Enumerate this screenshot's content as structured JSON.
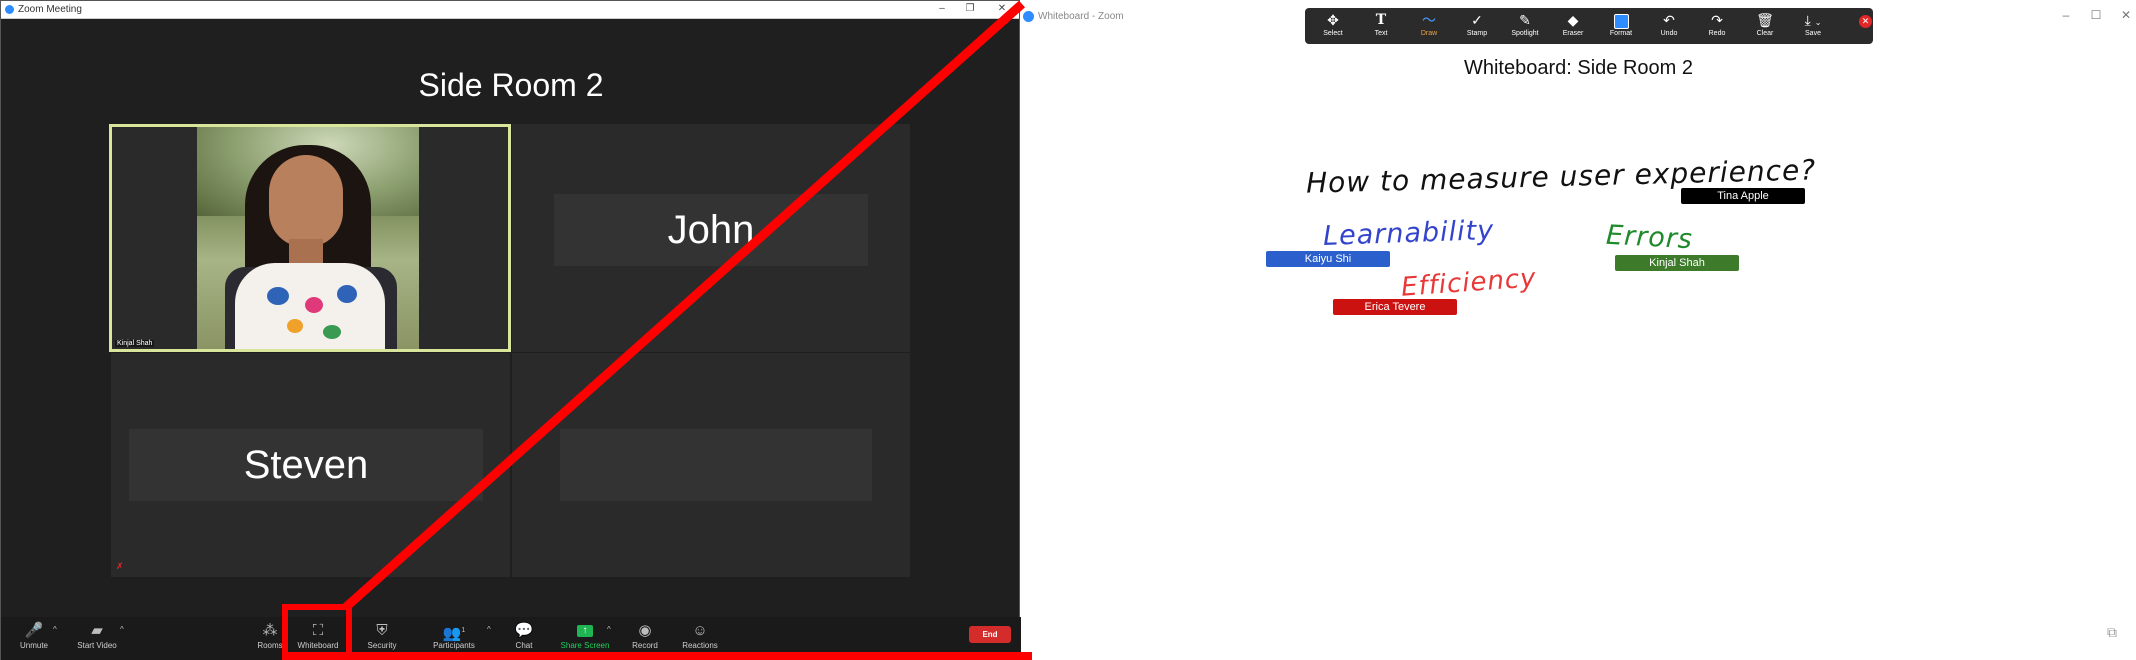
{
  "meeting_window": {
    "title": "Zoom Meeting",
    "room_title": "Side Room 2",
    "tiles": [
      {
        "name": "Kinjal Shah",
        "show_name_plate": false
      },
      {
        "name": "John"
      },
      {
        "name": "Steven"
      },
      {
        "name": ""
      }
    ],
    "toolbar": {
      "unmute": "Unmute",
      "start_video": "Start Video",
      "rooms": "Rooms",
      "whiteboard": "Whiteboard",
      "security": "Security",
      "participants": "Participants",
      "participants_count": "1",
      "chat": "Chat",
      "share_screen": "Share Screen",
      "record": "Record",
      "reactions": "Reactions",
      "end": "End"
    },
    "colors": {
      "share_accent": "#1fd15d",
      "end_red": "#d42b2b",
      "active_border": "#d8e59a"
    }
  },
  "whiteboard_window": {
    "title": "Whiteboard - Zoom",
    "board_title": "Whiteboard: Side Room 2",
    "tools": [
      {
        "id": "select",
        "label": "Select",
        "icon": "move-icon"
      },
      {
        "id": "text",
        "label": "Text",
        "icon": "text-icon"
      },
      {
        "id": "draw",
        "label": "Draw",
        "icon": "squiggle-icon",
        "active": true
      },
      {
        "id": "stamp",
        "label": "Stamp",
        "icon": "check-icon"
      },
      {
        "id": "spotlight",
        "label": "Spotlight",
        "icon": "wand-icon"
      },
      {
        "id": "eraser",
        "label": "Eraser",
        "icon": "eraser-icon"
      },
      {
        "id": "format",
        "label": "Format",
        "icon": "color-swatch-icon"
      },
      {
        "id": "undo",
        "label": "Undo",
        "icon": "undo-icon"
      },
      {
        "id": "redo",
        "label": "Redo",
        "icon": "redo-icon"
      },
      {
        "id": "clear",
        "label": "Clear",
        "icon": "trash-icon"
      },
      {
        "id": "save",
        "label": "Save",
        "icon": "download-icon"
      }
    ],
    "handwriting": {
      "question": "How to measure user experience?",
      "learnability": "Learnability",
      "errors": "Errors",
      "efficiency": "Efficiency"
    },
    "tags": [
      {
        "name": "Tina Apple",
        "color": "#000000"
      },
      {
        "name": "Kaiyu Shi",
        "color": "#2a5fcc"
      },
      {
        "name": "Kinjal Shah",
        "color": "#3d7a2a"
      },
      {
        "name": "Erica Tevere",
        "color": "#cc1111"
      }
    ]
  },
  "annotation_color": "#ff0000"
}
